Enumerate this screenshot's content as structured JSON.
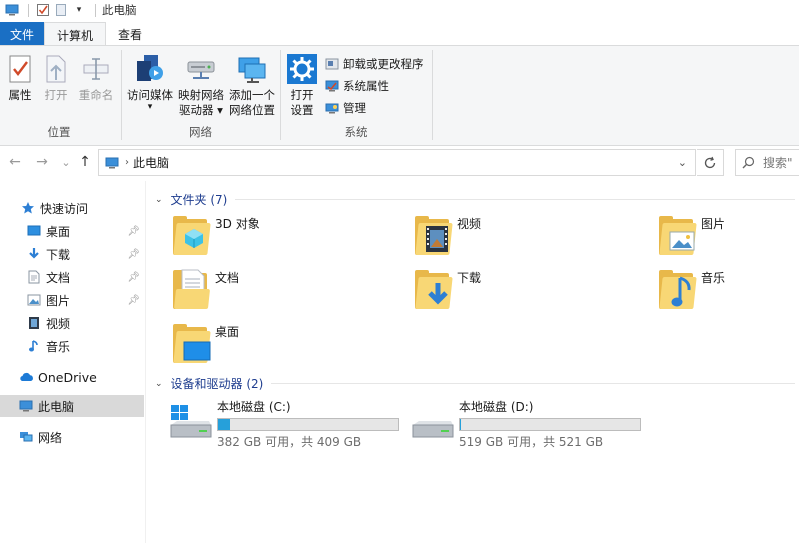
{
  "titlebar": {
    "title": "此电脑"
  },
  "tabs": {
    "file": "文件",
    "computer": "计算机",
    "view": "查看"
  },
  "ribbon": {
    "location": {
      "label": "位置",
      "properties": "属性",
      "open": "打开",
      "rename": "重命名"
    },
    "network": {
      "label": "网络",
      "access_media_1": "访问媒体",
      "access_media_2": "▾",
      "map_drive_1": "映射网络",
      "map_drive_2": "驱动器 ▾",
      "add_location_1": "添加一个",
      "add_location_2": "网络位置"
    },
    "system": {
      "label": "系统",
      "open_settings_1": "打开",
      "open_settings_2": "设置",
      "uninstall": "卸载或更改程序",
      "system_props": "系统属性",
      "manage": "管理"
    }
  },
  "nav": {
    "back": "←",
    "forward": "→",
    "recent": "⌄",
    "up": "↑",
    "breadcrumb": "此电脑",
    "search_placeholder": "搜索\""
  },
  "sidebar": {
    "quick_access": "快速访问",
    "items": [
      {
        "label": "桌面",
        "pinned": true
      },
      {
        "label": "下载",
        "pinned": true
      },
      {
        "label": "文档",
        "pinned": true
      },
      {
        "label": "图片",
        "pinned": true
      },
      {
        "label": "视频",
        "pinned": false
      },
      {
        "label": "音乐",
        "pinned": false
      }
    ],
    "onedrive": "OneDrive",
    "this_pc": "此电脑",
    "network": "网络"
  },
  "content": {
    "folders_header": "文件夹 (7)",
    "folders": [
      {
        "name": "3D 对象"
      },
      {
        "name": "视频"
      },
      {
        "name": "图片"
      },
      {
        "name": "文档"
      },
      {
        "name": "下载"
      },
      {
        "name": "音乐"
      },
      {
        "name": "桌面"
      }
    ],
    "devices_header": "设备和驱动器 (2)",
    "drives": [
      {
        "name": "本地磁盘 (C:)",
        "free_text": "382 GB 可用，共 409 GB",
        "used_fraction": 0.066
      },
      {
        "name": "本地磁盘 (D:)",
        "free_text": "519 GB 可用，共 521 GB",
        "used_fraction": 0.004
      }
    ]
  },
  "colors": {
    "accent": "#1a6fc4",
    "folder": "#f8d775",
    "drive_fill": "#26a0da",
    "header_text": "#1e3d8f"
  }
}
